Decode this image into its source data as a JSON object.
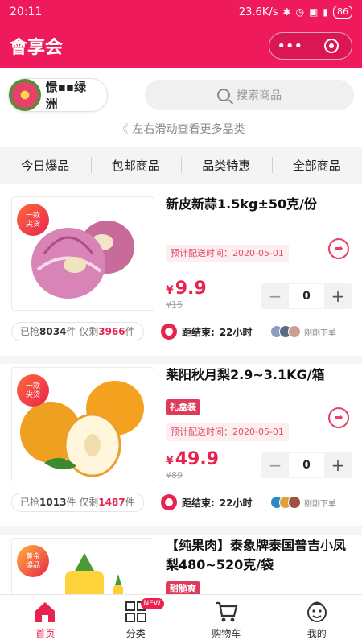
{
  "status_bar": {
    "time": "20:11",
    "speed": "23.6K/s",
    "battery": "86",
    "icons": [
      "bluetooth-icon",
      "alarm-icon",
      "hd-icon",
      "signal-icon"
    ]
  },
  "header": {
    "title": "會享会",
    "accent_color": "#ee1a5b",
    "menu_icon": "more-dots-icon",
    "close_icon": "target-close-icon"
  },
  "store": {
    "name": "憬▪▪绿洲"
  },
  "search": {
    "placeholder": "搜索商品"
  },
  "hint": "左右滑动查看更多品类",
  "tabs": [
    {
      "label": "今日爆品"
    },
    {
      "label": "包邮商品"
    },
    {
      "label": "品类特惠"
    },
    {
      "label": "全部商品"
    }
  ],
  "products": [
    {
      "badge": "一款\n尖货",
      "title": "新皮新蒜1.5kg±50克/份",
      "tag": "",
      "delivery": "预计配送时间：2020-05-01",
      "currency": "¥",
      "price": "9.9",
      "old_price": "¥15",
      "quantity": "0",
      "sold_prefix": "已抢",
      "sold": "8034",
      "remain_prefix": "件 仅剩",
      "remain": "3966",
      "unit": "件",
      "countdown_label": "距结束:",
      "countdown": "22小时",
      "buyers_text": "刚刚下单"
    },
    {
      "badge": "一款\n尖货",
      "title": "莱阳秋月梨2.9~3.1KG/箱",
      "tag": "礼盒装",
      "delivery": "预计配送时间：2020-05-01",
      "currency": "¥",
      "price": "49.9",
      "old_price": "¥89",
      "quantity": "0",
      "sold_prefix": "已抢",
      "sold": "1013",
      "remain_prefix": "件 仅剩",
      "remain": "1487",
      "unit": "件",
      "countdown_label": "距结束:",
      "countdown": "22小时",
      "buyers_text": "刚刚下单"
    },
    {
      "badge": "黄金\n爆品",
      "title": "【纯果肉】泰象牌泰国普吉小凤梨480~520克/袋",
      "tag": "甜脆爽"
    }
  ],
  "bottom_nav": [
    {
      "label": "首页",
      "icon": "home-icon",
      "active": true
    },
    {
      "label": "分类",
      "icon": "category-grid-icon",
      "badge": "NEW"
    },
    {
      "label": "购物车",
      "icon": "cart-icon"
    },
    {
      "label": "我的",
      "icon": "profile-icon"
    }
  ]
}
